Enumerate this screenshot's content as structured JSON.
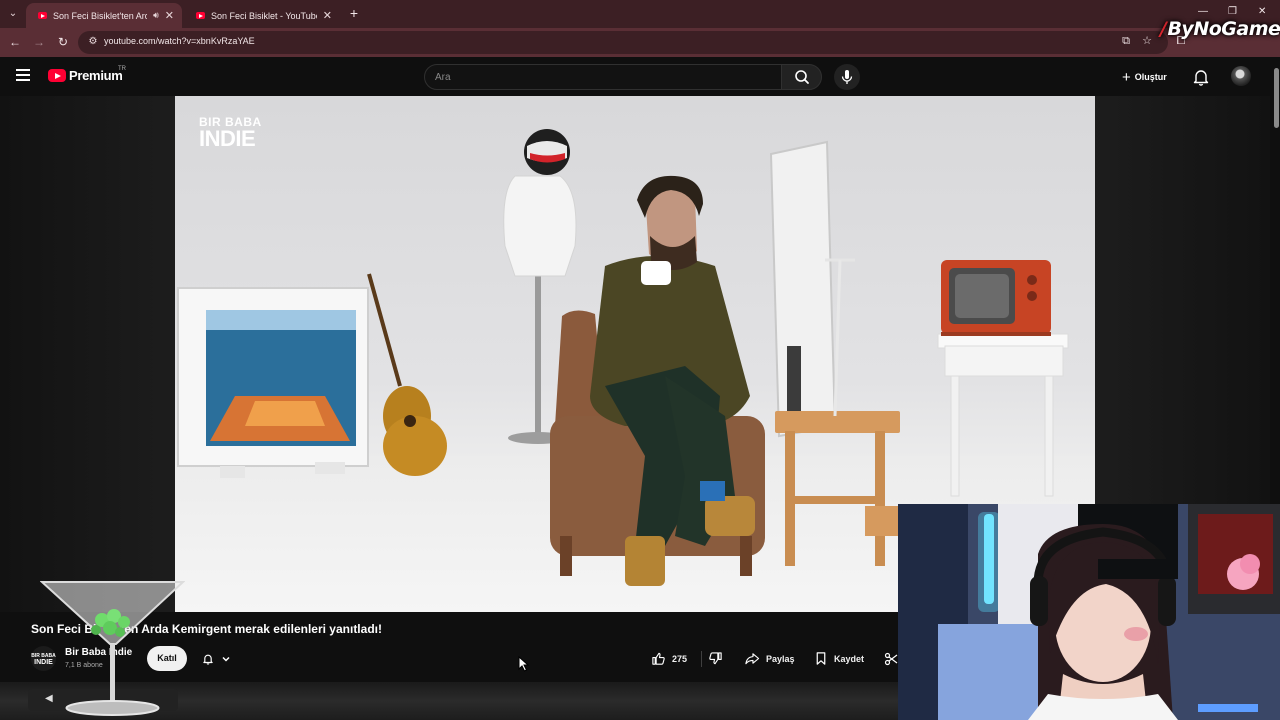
{
  "browser": {
    "tabs": [
      {
        "title": "Son Feci Bisiklet'ten Arda K",
        "active": true,
        "audio": true
      },
      {
        "title": "Son Feci Bisiklet - YouTube",
        "active": false,
        "audio": false
      }
    ],
    "url": "youtube.com/watch?v=xbnKvRzaYAE",
    "accent_color": "#5a2e35"
  },
  "overlay": {
    "watermark": "ByNoGame"
  },
  "youtube": {
    "brand": "Premium",
    "region": "TR",
    "search_placeholder": "Ara",
    "create_label": "Oluştur",
    "video_logo": {
      "line1": "BIR BABA",
      "line2": "INDIE"
    },
    "video": {
      "title": "Son Feci Bisiklet'ten Arda Kemirgent merak edilenleri yanıtladı!",
      "title_visible_start": "Son Feci Bi",
      "title_visible_end": "ten Arda Kemirgent merak edilenleri yanıtladı!",
      "channel": "Bir Baba Indie",
      "subscribers": "7,1 B abone",
      "join_label": "Katıl",
      "likes": "275",
      "share_label": "Paylaş",
      "save_label": "Kaydet"
    },
    "channel_avatar_text": {
      "line1": "BIR BABA",
      "line2": "INDIE"
    }
  },
  "icons": [
    "list-tabs-icon",
    "speaker-icon",
    "close-icon",
    "plus-icon",
    "back-icon",
    "forward-icon",
    "reload-icon",
    "site-info-icon",
    "install-icon",
    "star-icon",
    "extensions-icon",
    "menu-icon",
    "search-icon",
    "mic-icon",
    "bell-icon",
    "like-icon",
    "dislike-icon",
    "share-icon",
    "save-icon",
    "clip-icon",
    "chevron-down-icon",
    "cursor-icon"
  ]
}
